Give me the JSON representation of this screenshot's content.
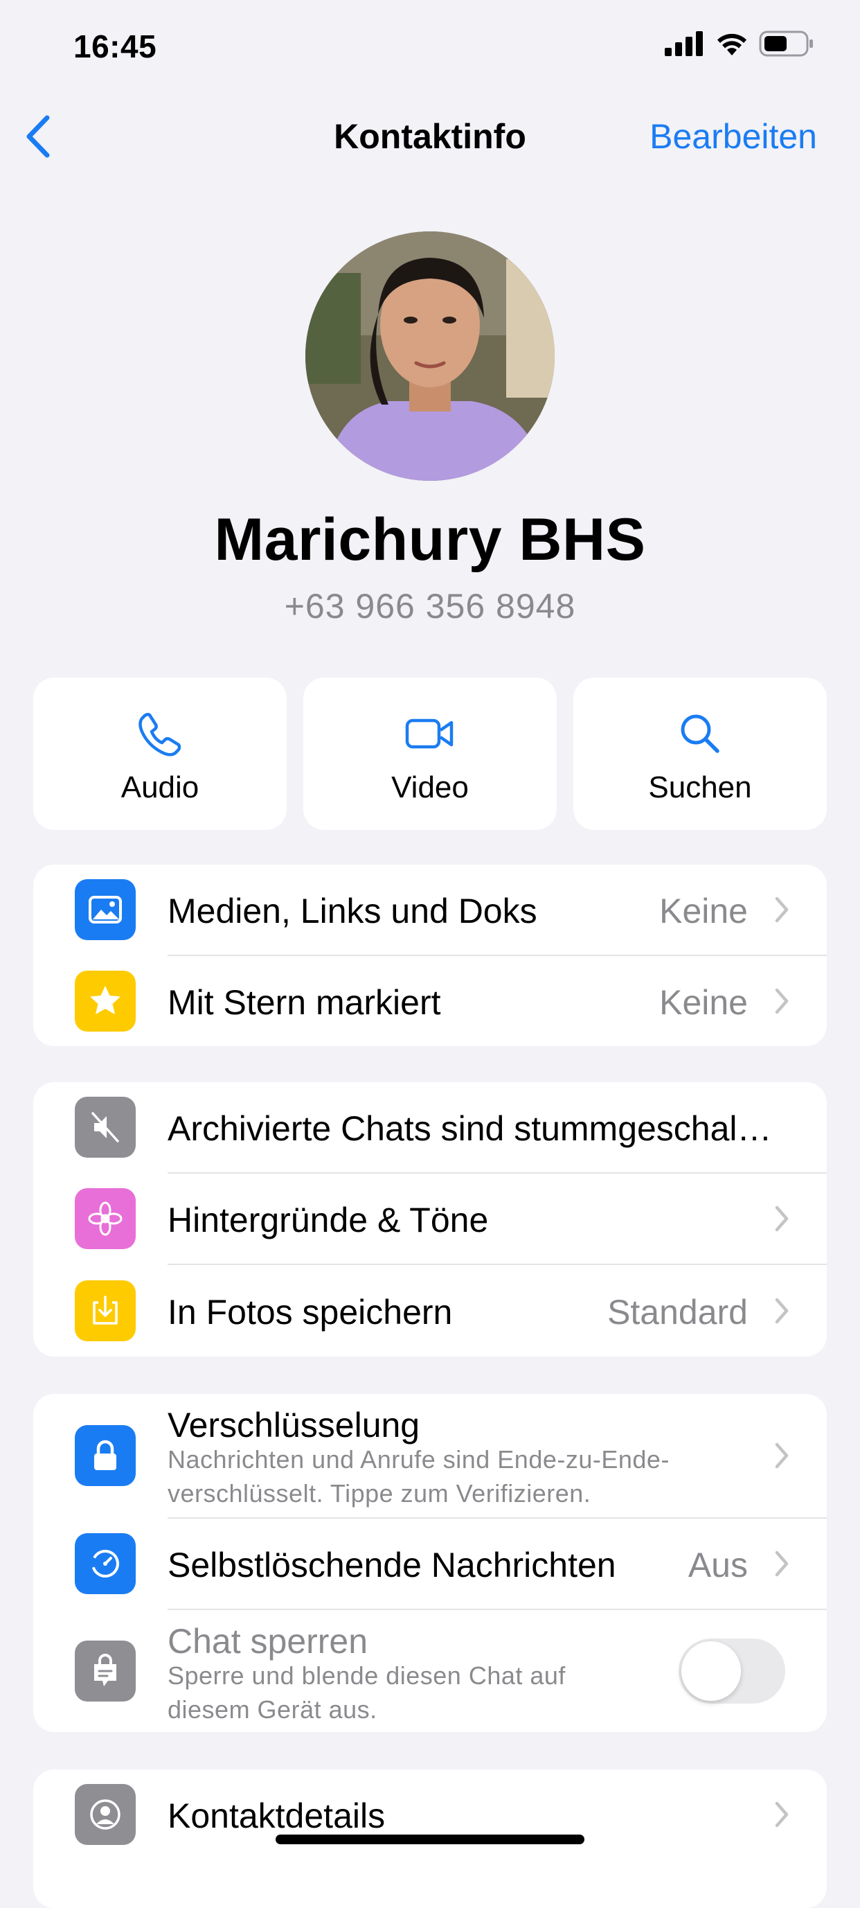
{
  "status_bar": {
    "time": "16:45"
  },
  "nav": {
    "back_icon": "chevron-left-icon",
    "title": "Kontaktinfo",
    "edit_label": "Bearbeiten"
  },
  "profile": {
    "name": "Marichury BHS",
    "phone": "+63 966 356 8948"
  },
  "actions": [
    {
      "label": "Audio",
      "icon": "phone-icon"
    },
    {
      "label": "Video",
      "icon": "video-camera-icon"
    },
    {
      "label": "Suchen",
      "icon": "search-icon"
    }
  ],
  "media_group": [
    {
      "label": "Medien, Links und Doks",
      "value": "Keine",
      "icon": "photo-icon",
      "color": "#1a7cf2"
    },
    {
      "label": "Mit Stern markiert",
      "value": "Keine",
      "icon": "star-icon",
      "color": "#fecb00"
    }
  ],
  "settings_group": [
    {
      "label": "Archivierte Chats sind stummgeschal…",
      "icon": "speaker-muted-icon",
      "color": "#8e8e93"
    },
    {
      "label": "Hintergründe & Töne",
      "icon": "flower-icon",
      "color": "#e86fd8"
    },
    {
      "label": "In Fotos speichern",
      "value": "Standard",
      "icon": "save-download-icon",
      "color": "#fecb00"
    }
  ],
  "privacy_group": {
    "encryption": {
      "label": "Verschlüsselung",
      "sub_line1": "Nachrichten und Anrufe sind Ende-zu-Ende-",
      "sub_line2": "verschlüsselt. Tippe zum Verifizieren.",
      "icon": "lock-icon",
      "color": "#1a7cf2"
    },
    "disappearing": {
      "label": "Selbstlöschende Nachrichten",
      "value": "Aus",
      "icon": "timer-icon",
      "color": "#1a7cf2"
    },
    "chat_lock": {
      "label": "Chat sperren",
      "sub_line1": "Sperre und blende diesen Chat auf",
      "sub_line2": "diesem Gerät aus.",
      "icon": "chat-lock-icon",
      "color": "#8e8e93",
      "toggle_on": false
    }
  },
  "contact_group": {
    "label": "Kontaktdetails",
    "icon": "person-circle-icon",
    "color": "#8e8e93"
  },
  "colors": {
    "accent": "#1a7cf2",
    "background": "#f2f2f7",
    "secondary_text": "#8a8a8e"
  }
}
